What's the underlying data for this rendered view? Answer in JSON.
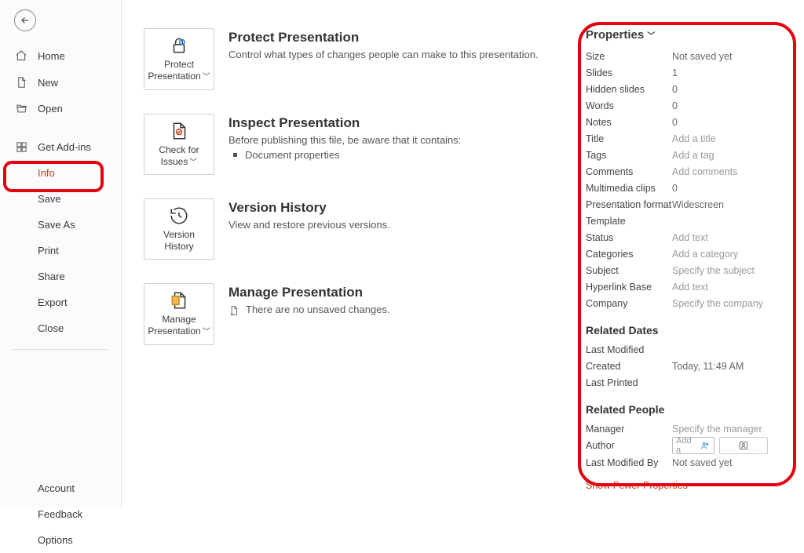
{
  "nav": {
    "home": "Home",
    "new": "New",
    "open": "Open",
    "addins": "Get Add-ins",
    "info": "Info",
    "save": "Save",
    "saveas": "Save As",
    "print": "Print",
    "share": "Share",
    "export": "Export",
    "close": "Close",
    "account": "Account",
    "feedback": "Feedback",
    "options": "Options"
  },
  "sections": {
    "protect": {
      "btn": "Protect Presentation",
      "title": "Protect Presentation",
      "desc": "Control what types of changes people can make to this presentation."
    },
    "inspect": {
      "btn": "Check for Issues",
      "title": "Inspect Presentation",
      "desc": "Before publishing this file, be aware that it contains:",
      "bullet1": "Document properties"
    },
    "history": {
      "btn": "Version History",
      "title": "Version History",
      "desc": "View and restore previous versions."
    },
    "manage": {
      "btn": "Manage Presentation",
      "title": "Manage Presentation",
      "desc": "There are no unsaved changes."
    }
  },
  "props": {
    "header": "Properties",
    "rows": {
      "size_l": "Size",
      "size_v": "Not saved yet",
      "slides_l": "Slides",
      "slides_v": "1",
      "hidden_l": "Hidden slides",
      "hidden_v": "0",
      "words_l": "Words",
      "words_v": "0",
      "notes_l": "Notes",
      "notes_v": "0",
      "title_l": "Title",
      "title_v": "Add a title",
      "tags_l": "Tags",
      "tags_v": "Add a tag",
      "comments_l": "Comments",
      "comments_v": "Add comments",
      "mm_l": "Multimedia clips",
      "mm_v": "0",
      "pf_l": "Presentation format",
      "pf_v": "Widescreen",
      "tmpl_l": "Template",
      "tmpl_v": "",
      "status_l": "Status",
      "status_v": "Add text",
      "cat_l": "Categories",
      "cat_v": "Add a category",
      "subj_l": "Subject",
      "subj_v": "Specify the subject",
      "hb_l": "Hyperlink Base",
      "hb_v": "Add text",
      "co_l": "Company",
      "co_v": "Specify the company"
    },
    "dates_header": "Related Dates",
    "dates": {
      "lm_l": "Last Modified",
      "lm_v": "",
      "cr_l": "Created",
      "cr_v": "Today, 11:49 AM",
      "lp_l": "Last Printed",
      "lp_v": ""
    },
    "people_header": "Related People",
    "people": {
      "mgr_l": "Manager",
      "mgr_v": "Specify the manager",
      "auth_l": "Author",
      "auth_ph": "Add a",
      "lmb_l": "Last Modified By",
      "lmb_v": "Not saved yet"
    },
    "show_fewer": "Show Fewer Properties"
  }
}
